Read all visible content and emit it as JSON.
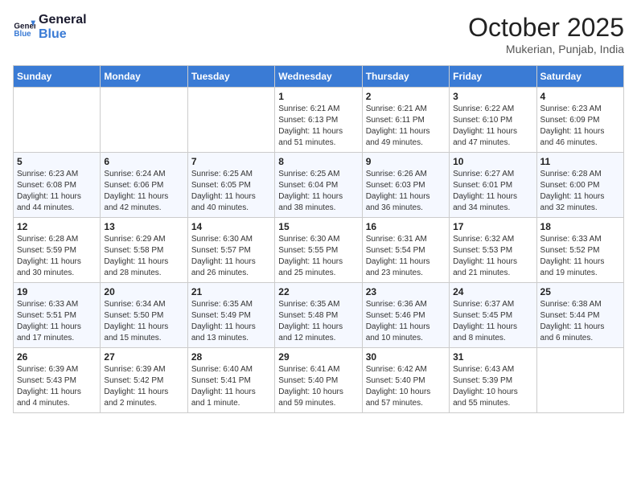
{
  "logo": {
    "line1": "General",
    "line2": "Blue"
  },
  "title": "October 2025",
  "location": "Mukerian, Punjab, India",
  "weekdays": [
    "Sunday",
    "Monday",
    "Tuesday",
    "Wednesday",
    "Thursday",
    "Friday",
    "Saturday"
  ],
  "weeks": [
    [
      {
        "day": "",
        "info": ""
      },
      {
        "day": "",
        "info": ""
      },
      {
        "day": "",
        "info": ""
      },
      {
        "day": "1",
        "info": "Sunrise: 6:21 AM\nSunset: 6:13 PM\nDaylight: 11 hours\nand 51 minutes."
      },
      {
        "day": "2",
        "info": "Sunrise: 6:21 AM\nSunset: 6:11 PM\nDaylight: 11 hours\nand 49 minutes."
      },
      {
        "day": "3",
        "info": "Sunrise: 6:22 AM\nSunset: 6:10 PM\nDaylight: 11 hours\nand 47 minutes."
      },
      {
        "day": "4",
        "info": "Sunrise: 6:23 AM\nSunset: 6:09 PM\nDaylight: 11 hours\nand 46 minutes."
      }
    ],
    [
      {
        "day": "5",
        "info": "Sunrise: 6:23 AM\nSunset: 6:08 PM\nDaylight: 11 hours\nand 44 minutes."
      },
      {
        "day": "6",
        "info": "Sunrise: 6:24 AM\nSunset: 6:06 PM\nDaylight: 11 hours\nand 42 minutes."
      },
      {
        "day": "7",
        "info": "Sunrise: 6:25 AM\nSunset: 6:05 PM\nDaylight: 11 hours\nand 40 minutes."
      },
      {
        "day": "8",
        "info": "Sunrise: 6:25 AM\nSunset: 6:04 PM\nDaylight: 11 hours\nand 38 minutes."
      },
      {
        "day": "9",
        "info": "Sunrise: 6:26 AM\nSunset: 6:03 PM\nDaylight: 11 hours\nand 36 minutes."
      },
      {
        "day": "10",
        "info": "Sunrise: 6:27 AM\nSunset: 6:01 PM\nDaylight: 11 hours\nand 34 minutes."
      },
      {
        "day": "11",
        "info": "Sunrise: 6:28 AM\nSunset: 6:00 PM\nDaylight: 11 hours\nand 32 minutes."
      }
    ],
    [
      {
        "day": "12",
        "info": "Sunrise: 6:28 AM\nSunset: 5:59 PM\nDaylight: 11 hours\nand 30 minutes."
      },
      {
        "day": "13",
        "info": "Sunrise: 6:29 AM\nSunset: 5:58 PM\nDaylight: 11 hours\nand 28 minutes."
      },
      {
        "day": "14",
        "info": "Sunrise: 6:30 AM\nSunset: 5:57 PM\nDaylight: 11 hours\nand 26 minutes."
      },
      {
        "day": "15",
        "info": "Sunrise: 6:30 AM\nSunset: 5:55 PM\nDaylight: 11 hours\nand 25 minutes."
      },
      {
        "day": "16",
        "info": "Sunrise: 6:31 AM\nSunset: 5:54 PM\nDaylight: 11 hours\nand 23 minutes."
      },
      {
        "day": "17",
        "info": "Sunrise: 6:32 AM\nSunset: 5:53 PM\nDaylight: 11 hours\nand 21 minutes."
      },
      {
        "day": "18",
        "info": "Sunrise: 6:33 AM\nSunset: 5:52 PM\nDaylight: 11 hours\nand 19 minutes."
      }
    ],
    [
      {
        "day": "19",
        "info": "Sunrise: 6:33 AM\nSunset: 5:51 PM\nDaylight: 11 hours\nand 17 minutes."
      },
      {
        "day": "20",
        "info": "Sunrise: 6:34 AM\nSunset: 5:50 PM\nDaylight: 11 hours\nand 15 minutes."
      },
      {
        "day": "21",
        "info": "Sunrise: 6:35 AM\nSunset: 5:49 PM\nDaylight: 11 hours\nand 13 minutes."
      },
      {
        "day": "22",
        "info": "Sunrise: 6:35 AM\nSunset: 5:48 PM\nDaylight: 11 hours\nand 12 minutes."
      },
      {
        "day": "23",
        "info": "Sunrise: 6:36 AM\nSunset: 5:46 PM\nDaylight: 11 hours\nand 10 minutes."
      },
      {
        "day": "24",
        "info": "Sunrise: 6:37 AM\nSunset: 5:45 PM\nDaylight: 11 hours\nand 8 minutes."
      },
      {
        "day": "25",
        "info": "Sunrise: 6:38 AM\nSunset: 5:44 PM\nDaylight: 11 hours\nand 6 minutes."
      }
    ],
    [
      {
        "day": "26",
        "info": "Sunrise: 6:39 AM\nSunset: 5:43 PM\nDaylight: 11 hours\nand 4 minutes."
      },
      {
        "day": "27",
        "info": "Sunrise: 6:39 AM\nSunset: 5:42 PM\nDaylight: 11 hours\nand 2 minutes."
      },
      {
        "day": "28",
        "info": "Sunrise: 6:40 AM\nSunset: 5:41 PM\nDaylight: 11 hours\nand 1 minute."
      },
      {
        "day": "29",
        "info": "Sunrise: 6:41 AM\nSunset: 5:40 PM\nDaylight: 10 hours\nand 59 minutes."
      },
      {
        "day": "30",
        "info": "Sunrise: 6:42 AM\nSunset: 5:40 PM\nDaylight: 10 hours\nand 57 minutes."
      },
      {
        "day": "31",
        "info": "Sunrise: 6:43 AM\nSunset: 5:39 PM\nDaylight: 10 hours\nand 55 minutes."
      },
      {
        "day": "",
        "info": ""
      }
    ]
  ]
}
